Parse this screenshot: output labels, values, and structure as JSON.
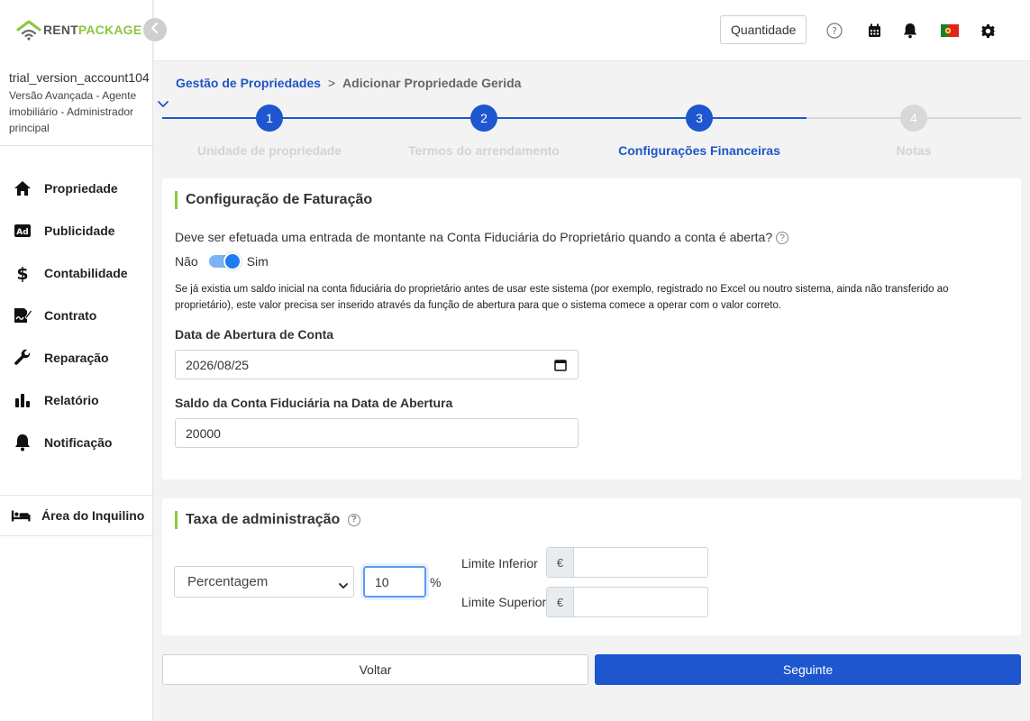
{
  "brand": {
    "rent": "RENT",
    "package": "PACKAGE",
    "accent": "#8dc63f",
    "primary": "#1d56cf"
  },
  "account": {
    "name": "trial_version_account104",
    "role": "Versão Avançada - Agente imobiliário - Administrador principal"
  },
  "nav": {
    "items": [
      {
        "label": "Propriedade",
        "icon": "home-icon"
      },
      {
        "label": "Publicidade",
        "icon": "ad-icon"
      },
      {
        "label": "Contabilidade",
        "icon": "dollar-icon"
      },
      {
        "label": "Contrato",
        "icon": "contract-icon"
      },
      {
        "label": "Reparação",
        "icon": "wrench-icon"
      },
      {
        "label": "Relatório",
        "icon": "bar-chart-icon"
      },
      {
        "label": "Notificação",
        "icon": "bell-icon"
      }
    ],
    "tenant_area": "Área do Inquilino"
  },
  "topbar": {
    "quantity_label": "Quantidade",
    "icons": [
      "help-icon",
      "calendar-icon",
      "bell-icon",
      "portugal-flag-icon",
      "gear-icon"
    ]
  },
  "breadcrumb": {
    "parent": "Gestão de Propriedades",
    "separator": ">",
    "current": "Adicionar Propriedade Gerida"
  },
  "stepper": {
    "steps": [
      {
        "number": "1",
        "label": "Unidade de propriedade",
        "state": "done"
      },
      {
        "number": "2",
        "label": "Termos do arrendamento",
        "state": "done"
      },
      {
        "number": "3",
        "label": "Configurações Financeiras",
        "state": "active"
      },
      {
        "number": "4",
        "label": "Notas",
        "state": "pending"
      }
    ]
  },
  "billing": {
    "title": "Configuração de Faturação",
    "question": "Deve ser efetuada uma entrada de montante na Conta Fiduciária do Proprietário quando a conta é aberta?",
    "toggle_off": "Não",
    "toggle_on": "Sim",
    "toggle_value": true,
    "note": "Se já existia um saldo inicial na conta fiduciária do proprietário antes de usar este sistema (por exemplo, registrado no Excel ou noutro sistema, ainda não transferido ao proprietário), este valor precisa ser inserido através da função de abertura para que o sistema comece a operar com o valor correto.",
    "opening_date_label": "Data de Abertura de Conta",
    "opening_date_value": "2026/08/25",
    "balance_label": "Saldo da Conta Fiduciária na Data de Abertura",
    "balance_value": "20000"
  },
  "admin_fee": {
    "title": "Taxa de administração",
    "type_value": "Percentagem",
    "percent_value": "10",
    "percent_sign": "%",
    "lower_limit_label": "Limite Inferior",
    "upper_limit_label": "Limite Superior",
    "currency_symbol": "€",
    "lower_limit_value": "",
    "upper_limit_value": ""
  },
  "actions": {
    "back_label": "Voltar",
    "next_label": "Seguinte"
  }
}
